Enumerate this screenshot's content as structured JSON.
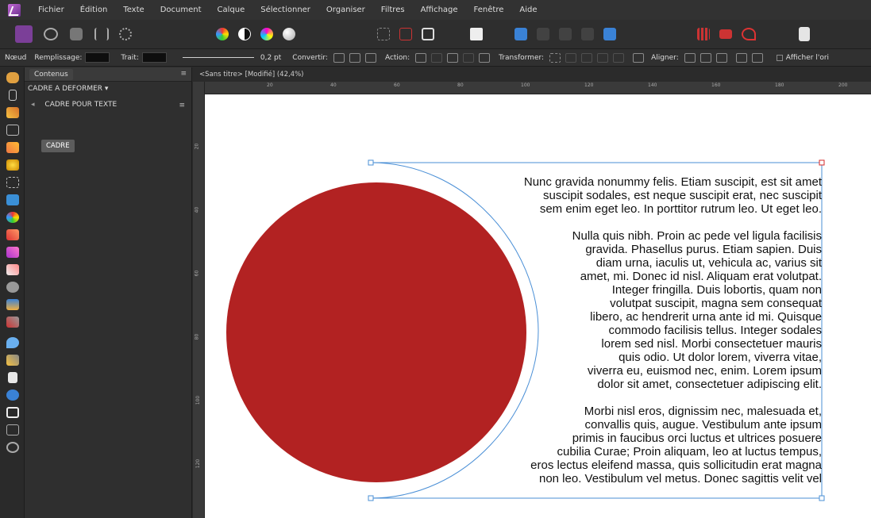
{
  "menu": [
    "Fichier",
    "Édition",
    "Texte",
    "Document",
    "Calque",
    "Sélectionner",
    "Organiser",
    "Filtres",
    "Affichage",
    "Fenêtre",
    "Aide"
  ],
  "context_bar": {
    "node_label": "Nœud",
    "fill_label": "Remplissage:",
    "stroke_label": "Trait:",
    "stroke_width": "0,2 pt",
    "convert_label": "Convertir:",
    "action_label": "Action:",
    "transform_label": "Transformer:",
    "align_label": "Aligner:",
    "show_label": "Afficher l'ori"
  },
  "panel": {
    "tab": "Contenus",
    "deform_dropdown": "CADRE A DEFORMER",
    "item": "CADRE POUR TEXTE",
    "chip": "CADRE"
  },
  "document_tab": "<Sans titre> [Modifié] (42,4%)",
  "rulers": {
    "unit": "mm",
    "top_ticks": [
      "20",
      "40",
      "60",
      "80",
      "100",
      "120",
      "140",
      "160",
      "180",
      "200"
    ],
    "left_ticks": [
      "20",
      "40",
      "60",
      "80",
      "100",
      "120"
    ]
  },
  "colors": {
    "circle": "#b22222",
    "frame": "#4a8fd6",
    "handle_selected": "#d62828"
  },
  "text_paragraphs": [
    [
      "Nunc gravida nonummy felis. Etiam suscipit, est sit amet",
      "suscipit sodales, est neque suscipit erat, nec suscipit",
      "sem enim eget leo. In porttitor rutrum leo. Ut eget leo."
    ],
    [
      "Nulla quis nibh. Proin ac pede vel ligula facilisis",
      "gravida. Phasellus purus. Etiam sapien. Duis",
      "diam urna, iaculis ut, vehicula ac, varius sit",
      "amet, mi. Donec id nisl. Aliquam erat volutpat.",
      "Integer fringilla. Duis lobortis, quam non",
      "volutpat suscipit, magna sem consequat",
      "libero, ac hendrerit urna ante id mi. Quisque",
      "commodo facilisis tellus. Integer sodales",
      "lorem sed nisl. Morbi consectetuer mauris",
      "quis odio. Ut dolor lorem, viverra vitae,",
      "viverra eu, euismod nec, enim. Lorem ipsum",
      "dolor sit amet, consectetuer adipiscing elit."
    ],
    [
      "Morbi nisl eros, dignissim nec, malesuada et,",
      "convallis quis, augue. Vestibulum ante ipsum",
      "primis in faucibus orci luctus et ultrices posuere",
      "cubilia Curae; Proin aliquam, leo at luctus tempus,",
      "eros lectus eleifend massa, quis sollicitudin erat magna",
      "non leo. Vestibulum vel metus. Donec sagittis velit vel"
    ]
  ]
}
